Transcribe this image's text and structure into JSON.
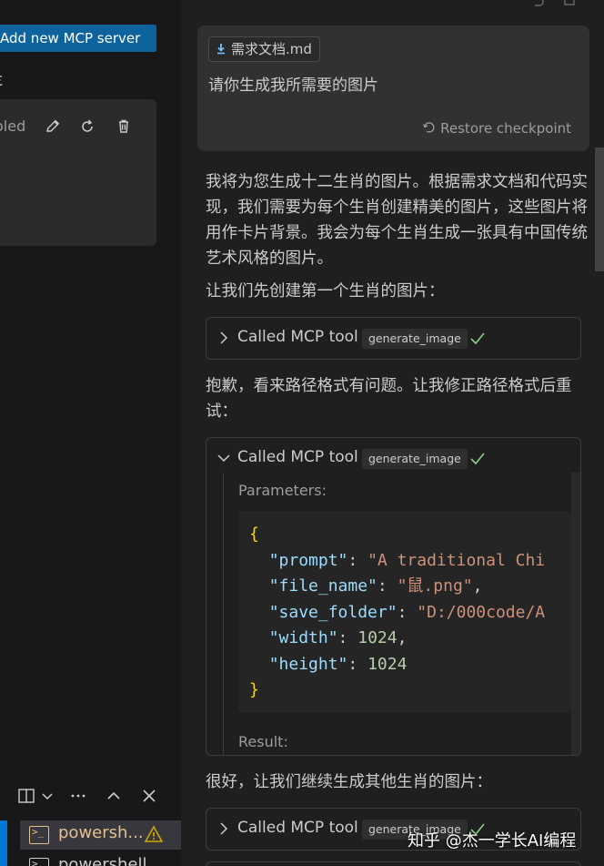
{
  "sidebar": {
    "add_button_label": "Add new MCP server",
    "left_glyph": "Ɛ",
    "server_status": "oled",
    "icons": [
      "pencil-icon",
      "refresh-icon",
      "trash-icon"
    ]
  },
  "terminal": {
    "items": [
      {
        "label": "powersh...",
        "icon": "terminal-icon",
        "warning": true
      },
      {
        "label": "powershell",
        "icon": "terminal-icon",
        "warning": false
      }
    ]
  },
  "chat": {
    "user": {
      "attachment": "需求文档.md",
      "message": "请你生成我所需要的图片",
      "restore_label": "Restore checkpoint"
    },
    "messages": {
      "intro": "我将为您生成十二生肖的图片。根据需求文档和代码实现，我们需要为每个生肖创建精美的图片，这些图片将用作卡片背景。我会为每个生肖生成一张具有中国传统艺术风格的图片。",
      "first": "让我们先创建第一个生肖的图片：",
      "error": "抱歉，看来路径格式有问题。让我修正路径格式后重试：",
      "continue": "很好，让我们继续生成其他生肖的图片："
    },
    "tool_calls": [
      {
        "title": "Called MCP tool",
        "tool": "generate_image",
        "expanded": false
      },
      {
        "title": "Called MCP tool",
        "tool": "generate_image",
        "expanded": true,
        "params_label": "Parameters:",
        "params": {
          "prompt": "\"A traditional Chi",
          "file_name": "\"鼠.png\"",
          "save_folder": "\"D:/000code/A",
          "width": "1024",
          "height": "1024"
        },
        "result_label": "Result:"
      },
      {
        "title": "Called MCP tool",
        "tool": "generate_image",
        "expanded": false
      }
    ]
  },
  "watermark": "知乎 @杰一学长AI编程",
  "colors": {
    "accent": "#0e639c",
    "check": "#89d185",
    "warning": "#cca700",
    "json_key": "#9cdcfe",
    "json_string": "#ce9178",
    "json_number": "#b5cea8",
    "json_brace": "#ffd700"
  }
}
